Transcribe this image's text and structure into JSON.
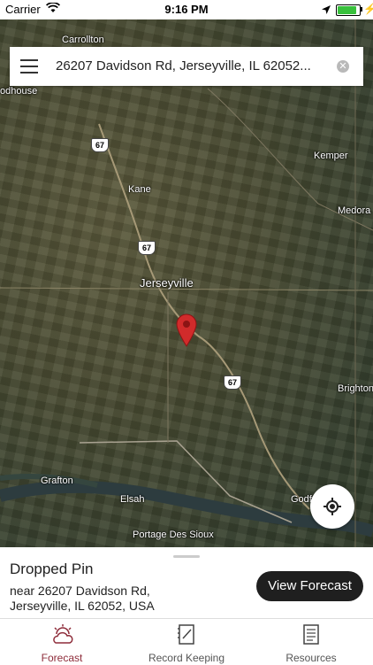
{
  "status_bar": {
    "carrier": "Carrier",
    "time": "9:16 PM"
  },
  "search": {
    "address": "26207 Davidson Rd, Jerseyville, IL 62052..."
  },
  "map": {
    "places": [
      {
        "name": "Carrollton"
      },
      {
        "name": "Roodhouse"
      },
      {
        "name": "Kane"
      },
      {
        "name": "Jerseyville"
      },
      {
        "name": "Kemper"
      },
      {
        "name": "Medora"
      },
      {
        "name": "Brighton"
      },
      {
        "name": "Grafton"
      },
      {
        "name": "Elsah"
      },
      {
        "name": "Godfrey"
      },
      {
        "name": "Portage Des Sioux"
      }
    ],
    "route_shield": "67"
  },
  "info_panel": {
    "title": "Dropped Pin",
    "address_line1": "near 26207 Davidson Rd,",
    "address_line2": "Jerseyville, IL 62052, USA",
    "button_label": "View Forecast"
  },
  "tabs": [
    {
      "label": "Forecast",
      "icon": "cloud-sun-icon",
      "active": true
    },
    {
      "label": "Record Keeping",
      "icon": "notebook-icon",
      "active": false
    },
    {
      "label": "Resources",
      "icon": "document-icon",
      "active": false
    }
  ],
  "colors": {
    "accent": "#8e2c3a",
    "pin": "#d12b2b",
    "button": "#1f1f1f"
  }
}
